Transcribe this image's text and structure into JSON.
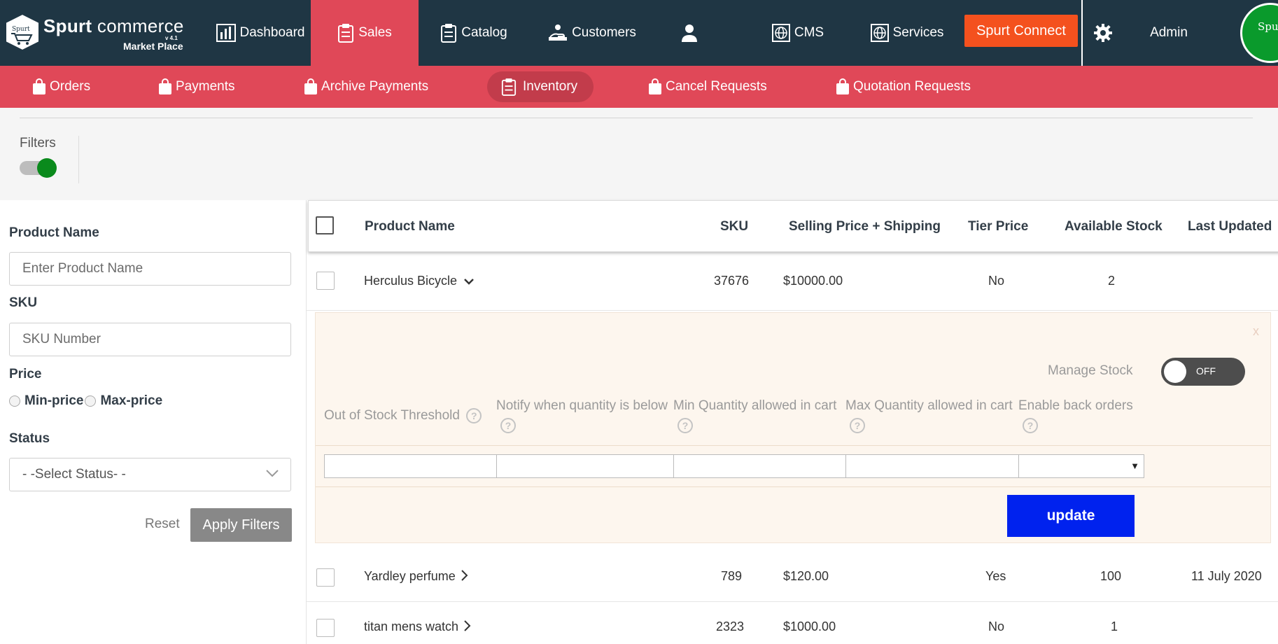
{
  "brand": {
    "badge_text": "Spurt",
    "title_bold": "Spurt",
    "title_rest": " commerce",
    "version": "v 4.1",
    "subtitle": "Market Place"
  },
  "topnav": {
    "items": [
      {
        "label": "Dashboard",
        "icon": "chart-icon"
      },
      {
        "label": "Sales",
        "icon": "clipboard-icon",
        "active": true
      },
      {
        "label": "Catalog",
        "icon": "clipboard-icon"
      },
      {
        "label": "Customers",
        "icon": "hand-icon"
      },
      {
        "label": "",
        "icon": "user-icon"
      },
      {
        "label": "CMS",
        "icon": "globe-icon"
      },
      {
        "label": "Services",
        "icon": "globe-icon"
      }
    ],
    "connect_label": "Spurt Connect",
    "settings_icon": "gear-icon",
    "admin_label": "Admin",
    "avatar_text": "Spur"
  },
  "subnav": {
    "items": [
      "Orders",
      "Payments",
      "Archive Payments",
      "Inventory",
      "Cancel Requests",
      "Quotation Requests"
    ],
    "active": "Inventory"
  },
  "filters": {
    "label": "Filters",
    "toggle_on": true
  },
  "sidebar": {
    "product_name_label": "Product Name",
    "product_name_placeholder": "Enter Product Name",
    "sku_label": "SKU",
    "sku_placeholder": "SKU Number",
    "price_label": "Price",
    "min_price": "Min-price",
    "max_price": "Max-price",
    "status_label": "Status",
    "status_selected": "- -Select Status- -",
    "reset_label": "Reset",
    "apply_label": "Apply Filters"
  },
  "table": {
    "headers": [
      "Product Name",
      "SKU",
      "Selling Price + Shipping",
      "Tier Price",
      "Available Stock",
      "Last Updated"
    ],
    "rows": [
      {
        "name": "Herculus Bicycle",
        "sku": "37676",
        "price": "$10000.00",
        "tier": "No",
        "stock": "2",
        "updated": "",
        "expanded": true
      },
      {
        "name": "Yardley perfume",
        "sku": "789",
        "price": "$120.00",
        "tier": "Yes",
        "stock": "100",
        "updated": "11 July 2020"
      },
      {
        "name": "titan mens watch",
        "sku": "2323",
        "price": "$1000.00",
        "tier": "No",
        "stock": "1",
        "updated": ""
      }
    ]
  },
  "panel": {
    "close": "x",
    "manage_stock_label": "Manage Stock",
    "manage_stock_state": "OFF",
    "fields": [
      "Out of Stock Threshold",
      "Notify when quantity is below",
      "Min Quantity allowed in cart",
      "Max Quantity allowed in cart",
      "Enable back orders"
    ],
    "help_glyph": "?",
    "select_arrow": "▼",
    "update_label": "update"
  },
  "colors": {
    "nav_bg": "#1f3644",
    "accent": "#e04858",
    "connect": "#f4511e",
    "update": "#0022ee"
  }
}
